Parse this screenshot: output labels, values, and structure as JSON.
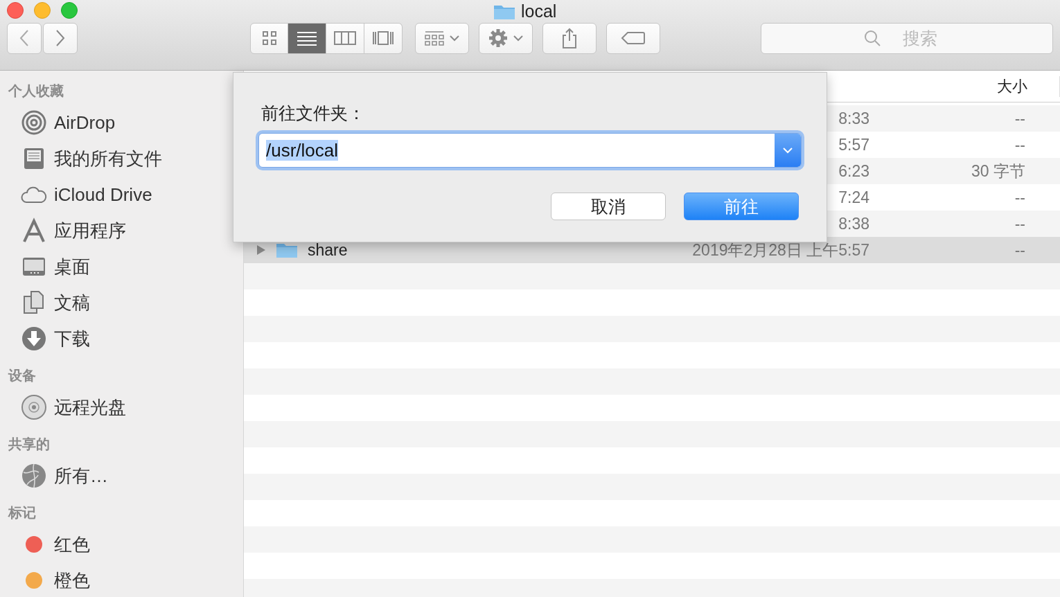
{
  "window": {
    "title": "local"
  },
  "toolbar": {
    "view_buttons": [
      {
        "kind": "icons",
        "selected": false
      },
      {
        "kind": "list",
        "selected": true
      },
      {
        "kind": "columns",
        "selected": false
      },
      {
        "kind": "gallery",
        "selected": false
      }
    ],
    "search": {
      "placeholder": "搜索"
    }
  },
  "sidebar": {
    "sections": [
      {
        "title": "个人收藏",
        "items": [
          {
            "label": "AirDrop",
            "kind": "airdrop"
          },
          {
            "label": "我的所有文件",
            "kind": "all-files"
          },
          {
            "label": "iCloud Drive",
            "kind": "cloud"
          },
          {
            "label": "应用程序",
            "kind": "apps"
          },
          {
            "label": "桌面",
            "kind": "desktop"
          },
          {
            "label": "文稿",
            "kind": "documents"
          },
          {
            "label": "下载",
            "kind": "downloads"
          }
        ]
      },
      {
        "title": "设备",
        "items": [
          {
            "label": "远程光盘",
            "kind": "disc"
          }
        ]
      },
      {
        "title": "共享的",
        "items": [
          {
            "label": "所有…",
            "kind": "network"
          }
        ]
      },
      {
        "title": "标记",
        "items": [
          {
            "label": "红色",
            "kind": "tag",
            "color": "#ee5f55"
          },
          {
            "label": "橙色",
            "kind": "tag",
            "color": "#f3a94b"
          }
        ]
      }
    ]
  },
  "table": {
    "columns": [
      "大小"
    ],
    "rows": [
      {
        "date": "8:33",
        "size": "--",
        "selected": false
      },
      {
        "date": "5:57",
        "size": "--",
        "selected": false
      },
      {
        "date": "6:23",
        "size": "30 字节",
        "selected": false
      },
      {
        "date": "7:24",
        "size": "--",
        "selected": false
      },
      {
        "date": "8:38",
        "size": "--",
        "selected": false
      },
      {
        "name": "share",
        "date": "2019年2月28日 上午5:57",
        "size": "--",
        "selected": true,
        "expanded": false
      }
    ]
  },
  "dialog": {
    "label": "前往文件夹：",
    "value": "/usr/local",
    "buttons": [
      {
        "label": "取消",
        "default": false
      },
      {
        "label": "前往",
        "default": true
      }
    ]
  }
}
